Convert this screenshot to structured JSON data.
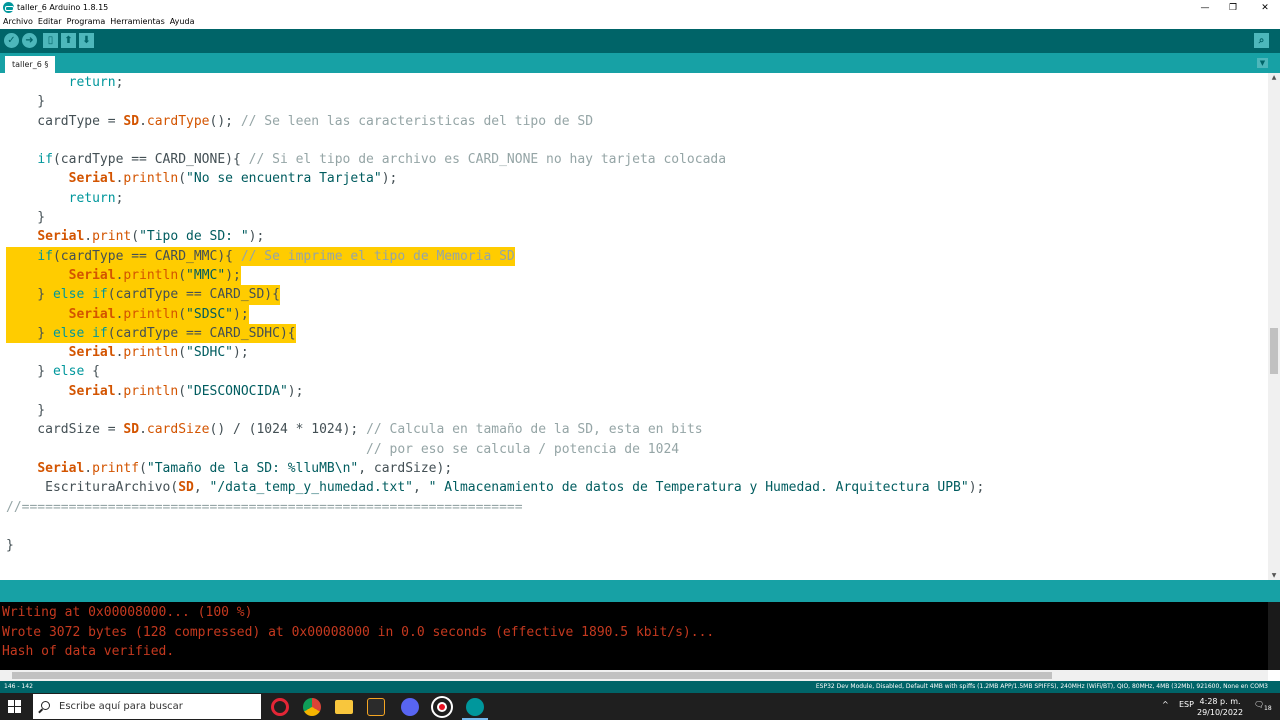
{
  "window": {
    "title": "taller_6 Arduino 1.8.15"
  },
  "menu": [
    "Archivo",
    "Editar",
    "Programa",
    "Herramientas",
    "Ayuda"
  ],
  "tab": {
    "label": "taller_6 §"
  },
  "colors": {
    "toolbar": "#006468",
    "tabbar": "#17a1a5",
    "highlight": "#ffcc00",
    "console_text": "#c5391f"
  },
  "code_lines": [
    "        return;",
    "    }",
    "    cardType = SD.cardType(); // Se leen las caracteristicas del tipo de SD",
    "",
    "    if(cardType == CARD_NONE){ // Si el tipo de archivo es CARD_NONE no hay tarjeta colocada",
    "        Serial.println(\"No se encuentra Tarjeta\");",
    "        return;",
    "    }",
    "    Serial.print(\"Tipo de SD: \");",
    "    if(cardType == CARD_MMC){ // Se imprime el tipo de Memoria SD",
    "        Serial.println(\"MMC\");",
    "    } else if(cardType == CARD_SD){",
    "        Serial.println(\"SDSC\");",
    "    } else if(cardType == CARD_SDHC){",
    "        Serial.println(\"SDHC\");",
    "    } else {",
    "        Serial.println(\"DESCONOCIDA\");",
    "    }",
    "    cardSize = SD.cardSize() / (1024 * 1024); // Calcula en tamaño de la SD, esta en bits",
    "                                              // por eso se calcula / potencia de 1024",
    "    Serial.printf(\"Tamaño de la SD: %lluMB\\n\", cardSize);",
    "     EscrituraArchivo(SD, \"/data_temp_y_humedad.txt\", \" Almacenamiento de datos de Temperatura y Humedad. Arquitectura UPB\");",
    "//================================================================",
    "",
    "}"
  ],
  "console": [
    "Writing at 0x00008000... (100 %)",
    "Wrote 3072 bytes (128 compressed) at 0x00008000 in 0.0 seconds (effective 1890.5 kbit/s)...",
    "Hash of data verified."
  ],
  "statusbar": {
    "line": "146 - 142",
    "board": "ESP32 Dev Module, Disabled, Default 4MB with spiffs (1.2MB APP/1.5MB SPIFFS), 240MHz (WiFi/BT), QIO, 80MHz, 4MB (32Mb), 921600, None en COM3"
  },
  "taskbar": {
    "search_placeholder": "Escribe aquí para buscar",
    "language": "ESP",
    "time": "4:28 p. m.",
    "date": "29/10/2022",
    "notifications": "18"
  }
}
